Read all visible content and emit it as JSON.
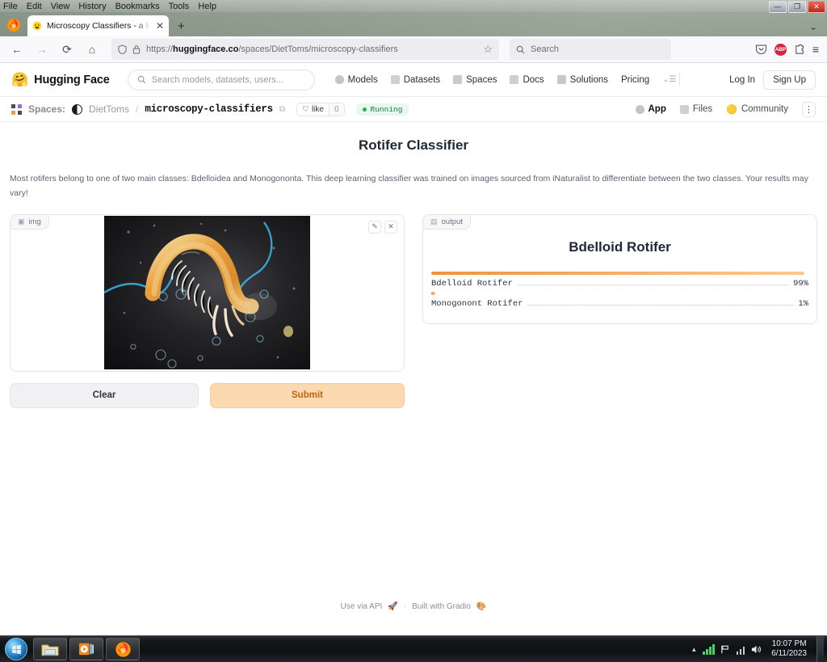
{
  "os": {
    "menubar": [
      "File",
      "Edit",
      "View",
      "History",
      "Bookmarks",
      "Tools",
      "Help"
    ],
    "window_controls": {
      "minimize": "—",
      "maximize": "❐",
      "close": "✕"
    },
    "taskbar": {
      "start_label": "start-orb",
      "items": [
        "file-explorer",
        "windows-media-player",
        "firefox"
      ],
      "tray": {
        "show_hidden": "▲",
        "time": "10:07 PM",
        "date": "6/11/2023"
      }
    }
  },
  "browser": {
    "tab": {
      "title": "Microscopy Classifiers - a Hugg",
      "close": "✕",
      "favicon": "huggingface-favicon"
    },
    "new_tab": "+",
    "nav": {
      "back": "←",
      "forward": "→",
      "reload": "⟳",
      "home": "⌂"
    },
    "urlbar": {
      "shield": "shield-icon",
      "lock": "lock-icon",
      "scheme": "https://",
      "domain": "huggingface.co",
      "path": "/spaces/DietToms/microscopy-classifiers",
      "bookmark": "☆"
    },
    "search": {
      "placeholder": "Search",
      "icon": "search-icon"
    },
    "toolbar_right": {
      "pocket": "pocket-icon",
      "abp": "ABP",
      "extensions": "puzzle-icon",
      "menu": "≡"
    }
  },
  "hf": {
    "brand": {
      "emoji": "🤗",
      "name": "Hugging Face"
    },
    "search_placeholder": "Search models, datasets, users...",
    "nav": [
      "Models",
      "Datasets",
      "Spaces",
      "Docs",
      "Solutions",
      "Pricing"
    ],
    "nav_more": "⌄☰",
    "login": "Log In",
    "signup": "Sign Up"
  },
  "space": {
    "label": "Spaces:",
    "owner": "DietToms",
    "separator": "/",
    "repo": "microscopy-classifiers",
    "copy_icon": "copy-icon",
    "like_label": "like",
    "like_count": "0",
    "status": "Running",
    "tabs": [
      {
        "label": "App",
        "icon": "app-icon",
        "active": true
      },
      {
        "label": "Files",
        "icon": "files-icon",
        "active": false
      },
      {
        "label": "Community",
        "icon": "community-icon",
        "active": false
      }
    ],
    "kebab": "⋮"
  },
  "app": {
    "title": "Rotifer Classifier",
    "description": "Most rotifers belong to one of two main classes: Bdelloidea and Monogononta. This deep learning classifier was trained on images sourced from iNaturalist to differentiate between the two classes. Your results may vary!",
    "input": {
      "tag": "img",
      "tag_icon": "image-icon",
      "edit_icon": "pencil-icon",
      "clear_icon": "close-icon",
      "photo_alt": "dark-field microscopy photo of an orange bdelloid rotifer"
    },
    "buttons": {
      "clear": "Clear",
      "submit": "Submit"
    },
    "output": {
      "tag": "output",
      "tag_icon": "label-icon",
      "top_label": "Bdelloid Rotifer"
    },
    "footer": {
      "api_label": "Use via API",
      "api_icon": "🚀",
      "separator": "·",
      "built_with": "Built with Gradio",
      "gradio_icon": "🎨"
    }
  },
  "chart_data": {
    "type": "bar",
    "title": "Bdelloid Rotifer",
    "categories": [
      "Bdelloid Rotifer",
      "Monogonont Rotifer"
    ],
    "values": [
      99,
      1
    ],
    "value_labels": [
      "99%",
      "1%"
    ],
    "unit": "%",
    "xlim": [
      0,
      100
    ],
    "orientation": "horizontal",
    "grid": false,
    "legend": "none",
    "bar_color": "#f0933a"
  },
  "colors": {
    "accent_orange": "#f0933a",
    "submit_bg": "#fcd9b0",
    "submit_text": "#c2650d",
    "status_green": "#1f7a43",
    "status_green_bg": "#e7f8ee"
  }
}
